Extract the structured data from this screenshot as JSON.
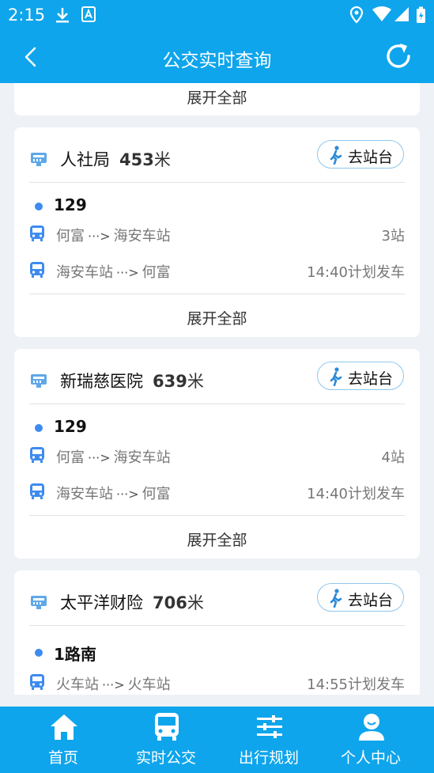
{
  "status_bar": {
    "time": "2:15"
  },
  "header": {
    "title": "公交实时查询"
  },
  "expand_label": "展开全部",
  "stations": [
    {
      "name": "人社局",
      "distance": "453",
      "unit": "米",
      "go_label": "去站台",
      "route": "129",
      "directions": [
        {
          "from": "何富",
          "arrow": "···>",
          "to": "海安车站",
          "info": "3站"
        },
        {
          "from": "海安车站",
          "arrow": "···>",
          "to": "何富",
          "info": "14:40计划发车"
        }
      ]
    },
    {
      "name": "新瑞慈医院",
      "distance": "639",
      "unit": "米",
      "go_label": "去站台",
      "route": "129",
      "directions": [
        {
          "from": "何富",
          "arrow": "···>",
          "to": "海安车站",
          "info": "4站"
        },
        {
          "from": "海安车站",
          "arrow": "···>",
          "to": "何富",
          "info": "14:40计划发车"
        }
      ]
    },
    {
      "name": "太平洋财险",
      "distance": "706",
      "unit": "米",
      "go_label": "去站台",
      "route": "1路南",
      "directions": [
        {
          "from": "火车站",
          "arrow": "···>",
          "to": "火车站",
          "info": "14:55计划发车"
        }
      ]
    }
  ],
  "bottom_nav": [
    {
      "label": "首页",
      "icon": "home-icon"
    },
    {
      "label": "实时公交",
      "icon": "bus-icon"
    },
    {
      "label": "出行规划",
      "icon": "sliders-icon"
    },
    {
      "label": "个人中心",
      "icon": "user-icon"
    }
  ],
  "colors": {
    "primary": "#0ea5ec",
    "route_dot": "#3d8bef",
    "bus_icon": "#3d8bef"
  }
}
